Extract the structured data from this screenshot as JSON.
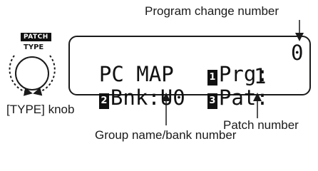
{
  "labels": {
    "program_change": "Program change number",
    "type_knob": "[TYPE] knob",
    "patch_number": "Patch number",
    "group_bank": "Group name/bank number"
  },
  "knob": {
    "badge": "PATCH",
    "type": "TYPE"
  },
  "lcd": {
    "line1_title": "PC MAP",
    "prg_marker": "1",
    "prg_label": "Prg:",
    "prg_value": "0",
    "bnk_marker": "2",
    "bnk_label": "Bnk:",
    "bnk_value": "U0",
    "pat_marker": "3",
    "pat_label": "Pat:",
    "pat_value": "1"
  },
  "colors": {
    "ink": "#1a1a1a",
    "background": "#ffffff"
  }
}
